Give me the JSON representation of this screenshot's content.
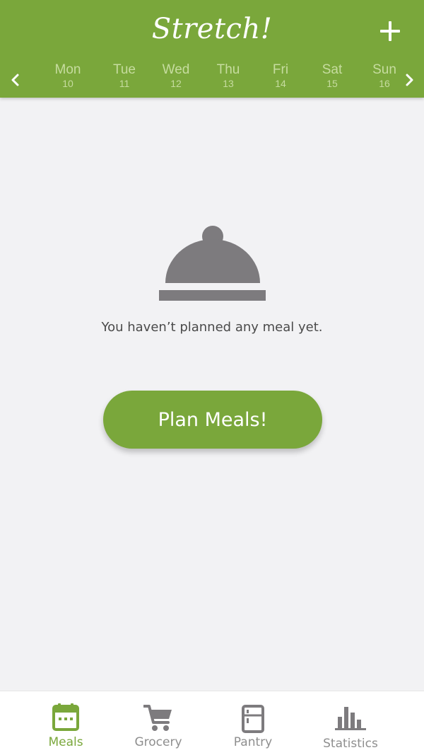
{
  "header": {
    "title": "Stretch!",
    "add_icon": "plus-icon",
    "prev_icon": "chevron-left-icon",
    "next_icon": "chevron-right-icon",
    "days": [
      {
        "name": "Mon",
        "date": "10"
      },
      {
        "name": "Tue",
        "date": "11"
      },
      {
        "name": "Wed",
        "date": "12"
      },
      {
        "name": "Thu",
        "date": "13"
      },
      {
        "name": "Fri",
        "date": "14"
      },
      {
        "name": "Sat",
        "date": "15"
      },
      {
        "name": "Sun",
        "date": "16"
      }
    ]
  },
  "empty_state": {
    "icon": "cloche-icon",
    "message": "You haven’t planned any meal yet.",
    "button_label": "Plan Meals!"
  },
  "bottom_nav": {
    "tabs": [
      {
        "label": "Meals",
        "icon": "calendar-icon",
        "active": true
      },
      {
        "label": "Grocery",
        "icon": "cart-icon",
        "active": false
      },
      {
        "label": "Pantry",
        "icon": "fridge-icon",
        "active": false
      },
      {
        "label": "Statistics",
        "icon": "bar-chart-icon",
        "active": false
      }
    ]
  },
  "colors": {
    "brand_green": "#7aa73b",
    "inactive_gray": "#8e8e8e",
    "icon_gray": "#7d7b7e",
    "background": "#f2f2f4"
  }
}
